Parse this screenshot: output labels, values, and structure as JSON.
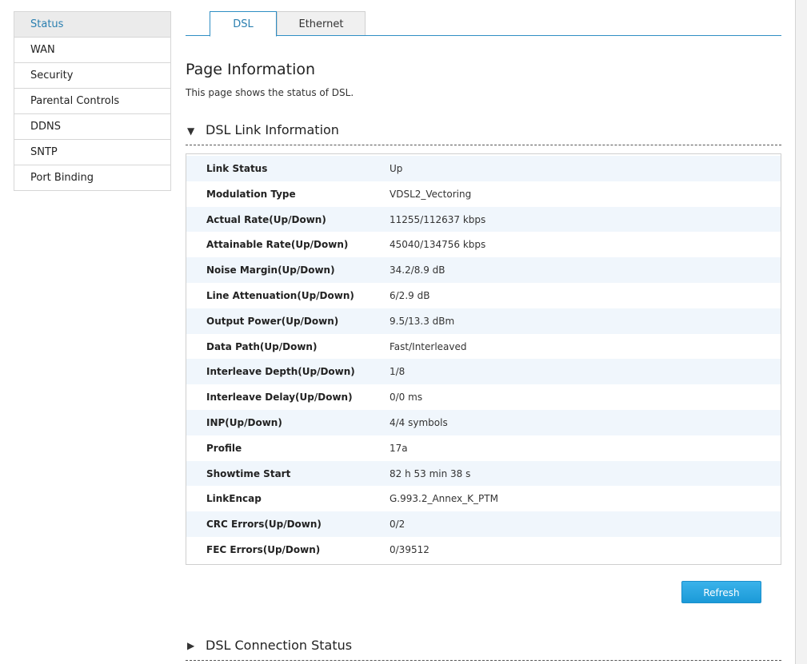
{
  "sidebar": {
    "items": [
      {
        "label": "Status"
      },
      {
        "label": "WAN"
      },
      {
        "label": "Security"
      },
      {
        "label": "Parental Controls"
      },
      {
        "label": "DDNS"
      },
      {
        "label": "SNTP"
      },
      {
        "label": "Port Binding"
      }
    ]
  },
  "tabs": [
    {
      "label": "DSL"
    },
    {
      "label": "Ethernet"
    }
  ],
  "page": {
    "title": "Page Information",
    "description": "This page shows the status of DSL."
  },
  "link_section": {
    "title": "DSL Link Information",
    "expanded_icon": "triangle-down-icon",
    "rows": [
      {
        "key": "Link Status",
        "value": "Up"
      },
      {
        "key": "Modulation Type",
        "value": "VDSL2_Vectoring"
      },
      {
        "key": "Actual Rate(Up/Down)",
        "value": "11255/112637 kbps"
      },
      {
        "key": "Attainable Rate(Up/Down)",
        "value": "45040/134756 kbps"
      },
      {
        "key": "Noise Margin(Up/Down)",
        "value": "34.2/8.9 dB"
      },
      {
        "key": "Line Attenuation(Up/Down)",
        "value": "6/2.9 dB"
      },
      {
        "key": "Output Power(Up/Down)",
        "value": "9.5/13.3 dBm"
      },
      {
        "key": "Data Path(Up/Down)",
        "value": "Fast/Interleaved"
      },
      {
        "key": "Interleave Depth(Up/Down)",
        "value": "1/8"
      },
      {
        "key": "Interleave Delay(Up/Down)",
        "value": "0/0 ms"
      },
      {
        "key": "INP(Up/Down)",
        "value": "4/4 symbols"
      },
      {
        "key": "Profile",
        "value": "17a"
      },
      {
        "key": "Showtime Start",
        "value": "82 h 53 min 38 s"
      },
      {
        "key": "LinkEncap",
        "value": "G.993.2_Annex_K_PTM"
      },
      {
        "key": "CRC Errors(Up/Down)",
        "value": "0/2"
      },
      {
        "key": "FEC Errors(Up/Down)",
        "value": "0/39512"
      }
    ]
  },
  "actions": {
    "refresh_label": "Refresh"
  },
  "connection_section": {
    "title": "DSL Connection Status",
    "collapsed_icon": "triangle-right-icon"
  },
  "colors": {
    "accent": "#2f8ec4",
    "button": "#1b9ad8",
    "row_stripe": "#f0f6fc"
  }
}
